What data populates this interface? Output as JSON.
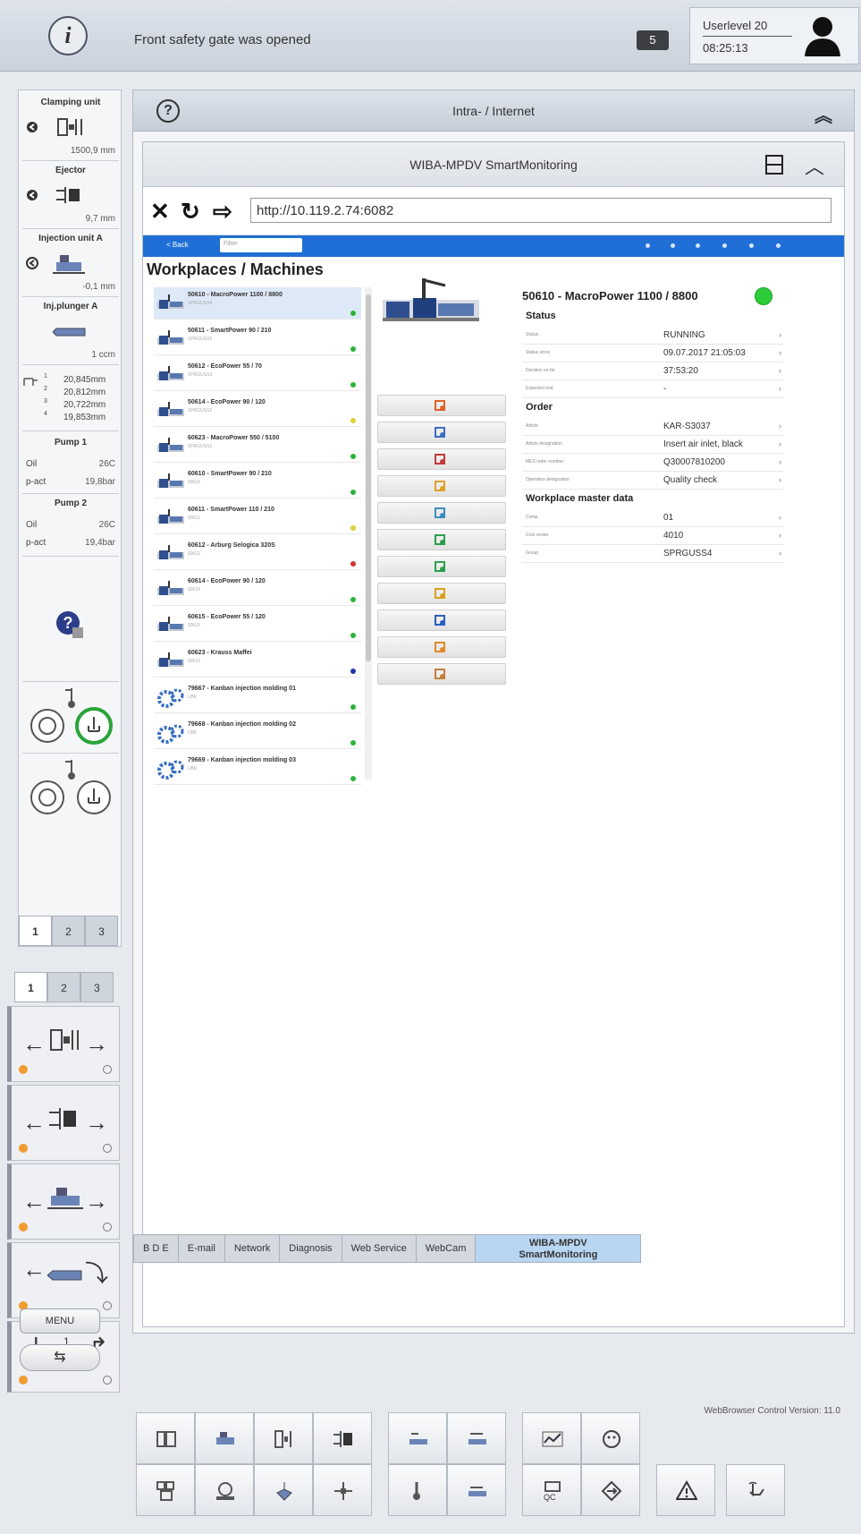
{
  "topbar": {
    "info_icon": "info-icon",
    "message": "Front safety gate was opened",
    "message_count": "5",
    "userlevel": "Userlevel 20",
    "time": "08:25:13",
    "user_icon": "user-icon"
  },
  "left": {
    "clamping_title": "Clamping unit",
    "clamping_value": "1500,9 mm",
    "ejector_title": "Ejector",
    "ejector_value": "9,7 mm",
    "injection_title": "Injection unit A",
    "injection_value": "-0,1 mm",
    "plunger_title": "Inj.plunger A",
    "plunger_value": "1 ccm",
    "sensors": [
      {
        "n": "1",
        "v": "20,845mm"
      },
      {
        "n": "2",
        "v": "20,812mm"
      },
      {
        "n": "3",
        "v": "20,722mm"
      },
      {
        "n": "4",
        "v": "19,853mm"
      }
    ],
    "pump1_title": "Pump 1",
    "pump1_oil_label": "Oil",
    "pump1_oil": "26C",
    "pump1_p_label": "p-act",
    "pump1_p": "19,8bar",
    "pump2_title": "Pump 2",
    "pump2_oil_label": "Oil",
    "pump2_oil": "26C",
    "pump2_p_label": "p-act",
    "pump2_p": "19,4bar",
    "tabs": [
      "1",
      "2",
      "3"
    ]
  },
  "axis_tabs": [
    "1",
    "2",
    "3"
  ],
  "main": {
    "intra_title": "Intra- / Internet",
    "wiba_title": "WIBA-MPDV SmartMonitoring",
    "url": "http://10.119.2.74:6082",
    "web": {
      "back": "< Back",
      "search": "Filter",
      "heading": "Workplaces / Machines",
      "machines": [
        {
          "title": "50610 - MacroPower 1100 / 8800",
          "sub": "SPRGUSS4",
          "status": "#2bb43a"
        },
        {
          "title": "50611 - SmartPower 90 / 210",
          "sub": "SPRGUSS5",
          "status": "#2bb43a"
        },
        {
          "title": "50612 - EcoPower 55 / 70",
          "sub": "SPRGUSS3",
          "status": "#2bb43a"
        },
        {
          "title": "50614 - EcoPower 90 / 120",
          "sub": "SPRGUSS2",
          "status": "#d8d234"
        },
        {
          "title": "60623 - MacroPower 550 / 5100",
          "sub": "SPRGUSS1",
          "status": "#2bb43a"
        },
        {
          "title": "60610 - SmartPower 90 / 210",
          "sub": "60610",
          "status": "#2bb43a"
        },
        {
          "title": "60611 - SmartPower 110 / 210",
          "sub": "60611",
          "status": "#d8d234"
        },
        {
          "title": "60612 - Arburg Selogica 320S",
          "sub": "60612",
          "status": "#d23434"
        },
        {
          "title": "60614 - EcoPower 90 / 120",
          "sub": "60614",
          "status": "#2bb43a"
        },
        {
          "title": "60615 - EcoPower 55 / 120",
          "sub": "60615",
          "status": "#2bb43a"
        },
        {
          "title": "60623 - Krauss Maffei",
          "sub": "60623",
          "status": "#2233aa"
        },
        {
          "title": "79667 - Kanban injection molding 01",
          "sub": "UBK",
          "status": "#2bb43a"
        },
        {
          "title": "79668 - Kanban injection molding 02",
          "sub": "UBK",
          "status": "#2bb43a"
        },
        {
          "title": "79669 - Kanban injection molding 03",
          "sub": "UBK",
          "status": "#2bb43a"
        }
      ],
      "detail_title": "50610 - MacroPower 1100 / 8800",
      "status_section": "Status",
      "status_rows": [
        {
          "k": "Status",
          "v": "RUNNING"
        },
        {
          "k": "Status since",
          "v": "09.07.2017 21:05:03"
        },
        {
          "k": "Duration so far",
          "v": "37:53:20"
        },
        {
          "k": "Expected end",
          "v": "-"
        }
      ],
      "order_section": "Order",
      "order_rows": [
        {
          "k": "Article",
          "v": "KAR-S3037"
        },
        {
          "k": "Article designation",
          "v": "Insert air inlet, black"
        },
        {
          "k": "MES order number",
          "v": "Q30007810200"
        },
        {
          "k": "Operation designation",
          "v": "Quality check"
        }
      ],
      "master_section": "Workplace master data",
      "master_rows": [
        {
          "k": "Comp.",
          "v": "01"
        },
        {
          "k": "Cost center",
          "v": "4010"
        },
        {
          "k": "Group",
          "v": "SPRGUSS4"
        }
      ],
      "function_buttons": [
        "chart-icon",
        "search-icon",
        "report-icon",
        "folder-icon",
        "settings-icon",
        "document-ok-icon",
        "document-refresh-icon",
        "document-edit-icon",
        "document-info-icon",
        "user-icon",
        "tools-icon"
      ]
    },
    "version": "WebBrowser Control Version: 11.0",
    "bottom_tabs": [
      "B D E",
      "E-mail",
      "Network",
      "Diagnosis",
      "Web Service",
      "WebCam"
    ],
    "bottom_tab_active_line1": "WIBA-MPDV",
    "bottom_tab_active_line2": "SmartMonitoring"
  },
  "toolbar": {
    "menu": "MENU",
    "undo_icon": "undo-redo-icon"
  },
  "colors": {
    "accent": "#1f6fd6",
    "selected": "#b8d5f2",
    "running": "#2dcc3a",
    "warning": "#f29b2f"
  }
}
